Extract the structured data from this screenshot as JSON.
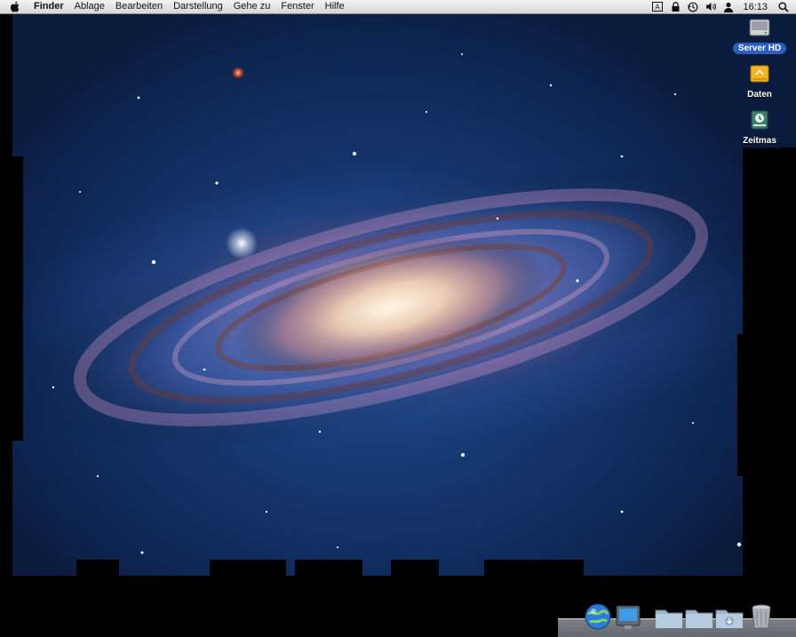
{
  "menubar": {
    "apple_icon": "apple-icon",
    "app_name": "Finder",
    "items": [
      "Ablage",
      "Bearbeiten",
      "Darstellung",
      "Gehe zu",
      "Fenster",
      "Hilfe"
    ],
    "status_icons": [
      "keyboard-icon",
      "lock-icon",
      "time-machine-icon",
      "volume-icon",
      "user-icon"
    ],
    "clock": "16:13",
    "spotlight_icon": "spotlight-icon"
  },
  "desktop": {
    "icons": [
      {
        "label": "Server HD",
        "icon": "hard-drive-icon",
        "selected": true
      },
      {
        "label": "Daten",
        "icon": "external-drive-icon",
        "selected": false
      },
      {
        "label": "Zeitmas",
        "icon": "time-machine-drive-icon",
        "selected": false
      }
    ]
  },
  "dock": {
    "items": [
      "globe-app-icon",
      "system-preferences-icon",
      "applications-folder-icon",
      "documents-folder-icon",
      "downloads-folder-icon",
      "trash-icon"
    ]
  },
  "colors": {
    "menubar_top": "#f4f4f4",
    "menubar_bottom": "#d6d6d6",
    "selection": "#2a5fbf",
    "space_blue": "#1f4b8e"
  }
}
